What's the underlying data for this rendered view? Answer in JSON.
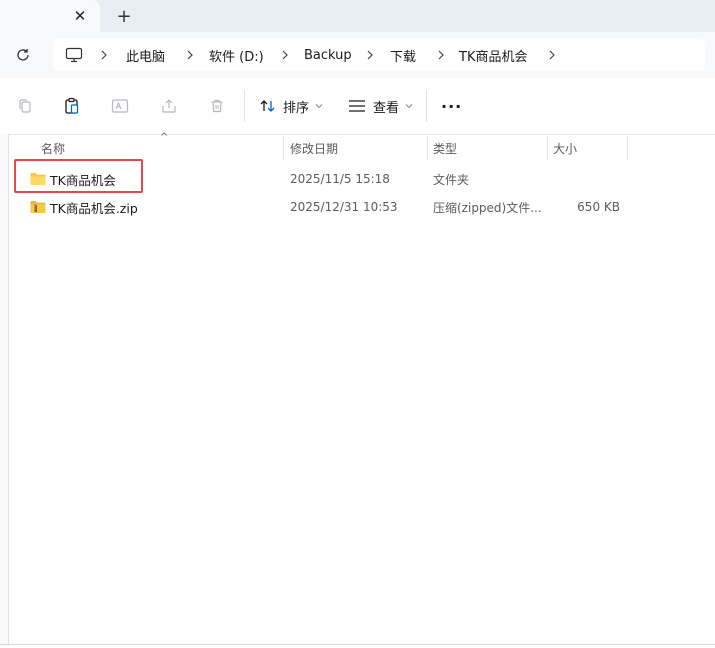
{
  "tabs": {
    "close_glyph": "✕",
    "new_glyph": "+"
  },
  "address": {
    "breadcrumbs": [
      "此电脑",
      "软件 (D:)",
      "Backup",
      "下载",
      "TK商品机会"
    ]
  },
  "toolbar": {
    "sort_label": "排序",
    "view_label": "查看",
    "more_label": "···"
  },
  "columns": {
    "name": "名称",
    "modified": "修改日期",
    "type": "类型",
    "size": "大小"
  },
  "files": [
    {
      "name": "TK商品机会",
      "modified": "2025/11/5 15:18",
      "type": "文件夹",
      "size": "",
      "icon": "folder-icon"
    },
    {
      "name": "TK商品机会.zip",
      "modified": "2025/12/31 10:53",
      "type": "压缩(zipped)文件...",
      "size": "650 KB",
      "icon": "zip-folder-icon"
    }
  ],
  "colors": {
    "highlight": "#e5484d",
    "folder": "#f4c74d",
    "accent": "#0067c0"
  }
}
